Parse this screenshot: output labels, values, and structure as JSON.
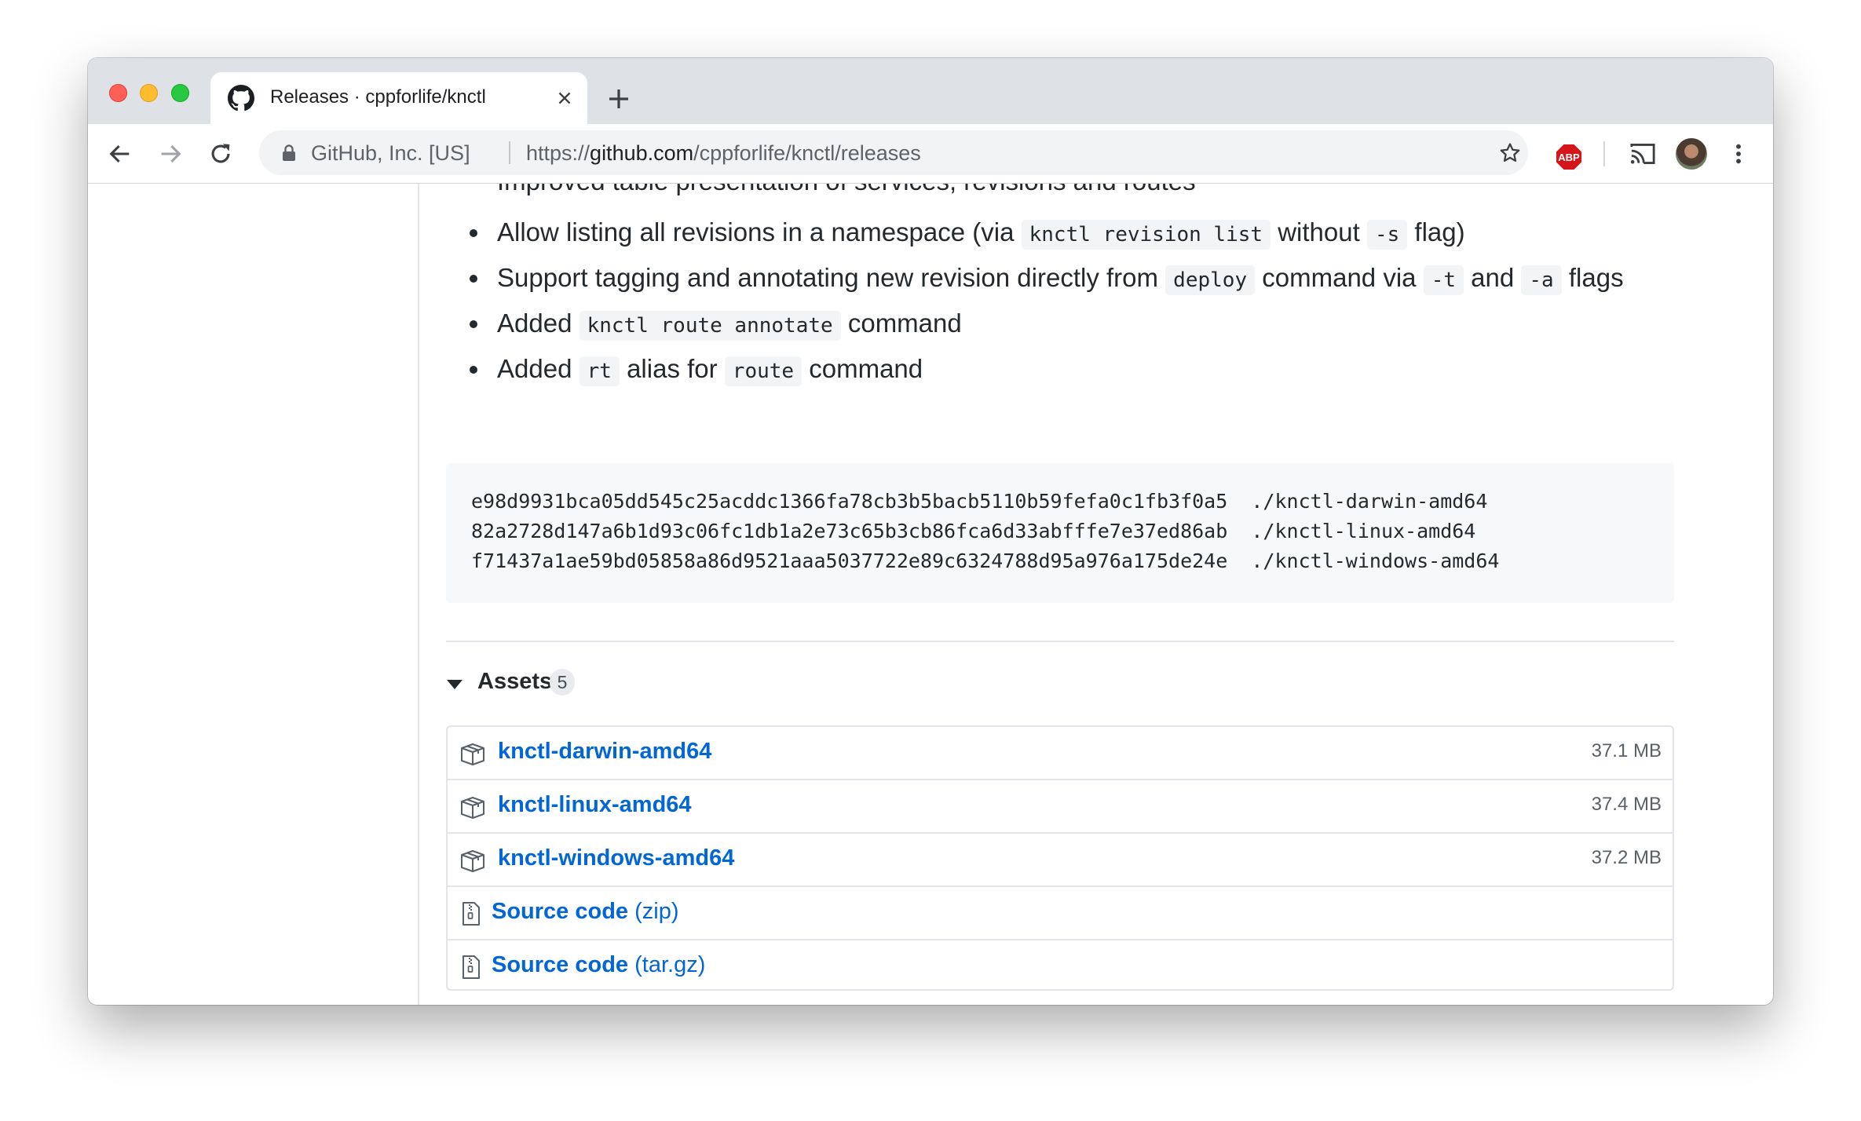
{
  "browser": {
    "tab": {
      "title": "Releases · cppforlife/knctl"
    },
    "omnibox": {
      "site_identity": "GitHub, Inc. [US]",
      "url_scheme": "https://",
      "url_host": "github.com",
      "url_path": "/cppforlife/knctl/releases"
    },
    "extension_badge": "ABP"
  },
  "release_notes": {
    "partial_line": "Improved table presentation of services, revisions and routes",
    "items": [
      {
        "t1": "Allow listing all revisions in a namespace (via ",
        "c1": "knctl revision list",
        "t2": " without ",
        "c2": "-s",
        "t3": " flag)"
      },
      {
        "t1": "Support tagging and annotating new revision directly from ",
        "c1": "deploy",
        "t2": " command via ",
        "c2": "-t",
        "t3": " and ",
        "c3": "-a",
        "t4": " flags"
      },
      {
        "t1": "Added ",
        "c1": "knctl route annotate",
        "t2": " command"
      },
      {
        "t1": "Added ",
        "c1": "rt",
        "t2": " alias for ",
        "c2": "route",
        "t3": " command"
      }
    ],
    "checksums": [
      "e98d9931bca05dd545c25acddc1366fa78cb3b5bacb5110b59fefa0c1fb3f0a5  ./knctl-darwin-amd64",
      "82a2728d147a6b1d93c06fc1db1a2e73c65b3cb86fca6d33abfffe7e37ed86ab  ./knctl-linux-amd64",
      "f71437a1ae59bd05858a86d9521aaa5037722e89c6324788d95a976a175de24e  ./knctl-windows-amd64"
    ]
  },
  "assets": {
    "label": "Assets",
    "count": "5",
    "files": [
      {
        "name": "knctl-darwin-amd64",
        "size": "37.1 MB"
      },
      {
        "name": "knctl-linux-amd64",
        "size": "37.4 MB"
      },
      {
        "name": "knctl-windows-amd64",
        "size": "37.2 MB"
      }
    ],
    "sources": [
      {
        "name": "Source code",
        "format": "(zip)"
      },
      {
        "name": "Source code",
        "format": "(tar.gz)"
      }
    ]
  },
  "colors": {
    "link": "#0366d6",
    "text": "#24292e",
    "muted": "#586069",
    "abp_red": "#d4161c"
  },
  "icons": {
    "tab_favicon": "github-icon",
    "asset": "package-icon",
    "source": "file-zip-icon"
  }
}
